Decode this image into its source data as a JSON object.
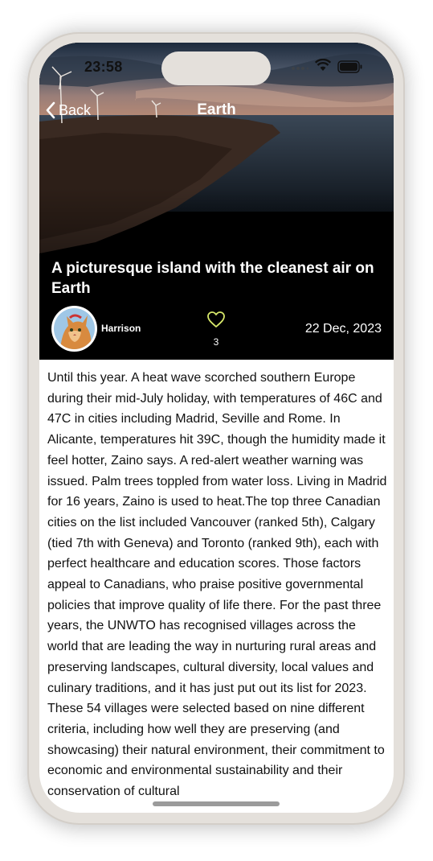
{
  "status_bar": {
    "time": "23:58"
  },
  "nav": {
    "back_label": "Back",
    "title": "Earth"
  },
  "article": {
    "headline": "A picturesque island with the cleanest air on Earth",
    "author": "Harrison",
    "likes": "3",
    "date": "22 Dec, 2023",
    "body": "Until this year. A heat wave scorched southern Europe during their mid-July holiday, with temperatures of 46C and 47C in cities including Madrid, Seville and Rome. In Alicante, temperatures hit 39C, though the humidity made it feel hotter, Zaino says. A red-alert weather warning was issued. Palm trees toppled from water loss. Living in Madrid for 16 years, Zaino is used to heat.The top three Canadian cities on the list included Vancouver (ranked 5th), Calgary (tied 7th with Geneva) and Toronto (ranked 9th), each with perfect healthcare and education scores. Those factors appeal to Canadians, who praise positive governmental policies that improve quality of life there. For the past three years, the UNWTO has recognised villages across the world that are leading the way in nurturing rural areas and preserving landscapes, cultural diversity, local values and culinary traditions, and it has just put out its list for 2023. These 54 villages were selected based on nine different criteria, including how well they are preserving (and showcasing) their natural environment, their commitment to economic and environmental sustainability and their conservation of cultural"
  },
  "colors": {
    "like_icon": "#d7e86a",
    "phone_frame": "#e4e0db",
    "hero_overlay": "#000000"
  },
  "icons": [
    "signal-icon",
    "wifi-icon",
    "battery-icon",
    "chevron-left-icon",
    "heart-icon"
  ]
}
